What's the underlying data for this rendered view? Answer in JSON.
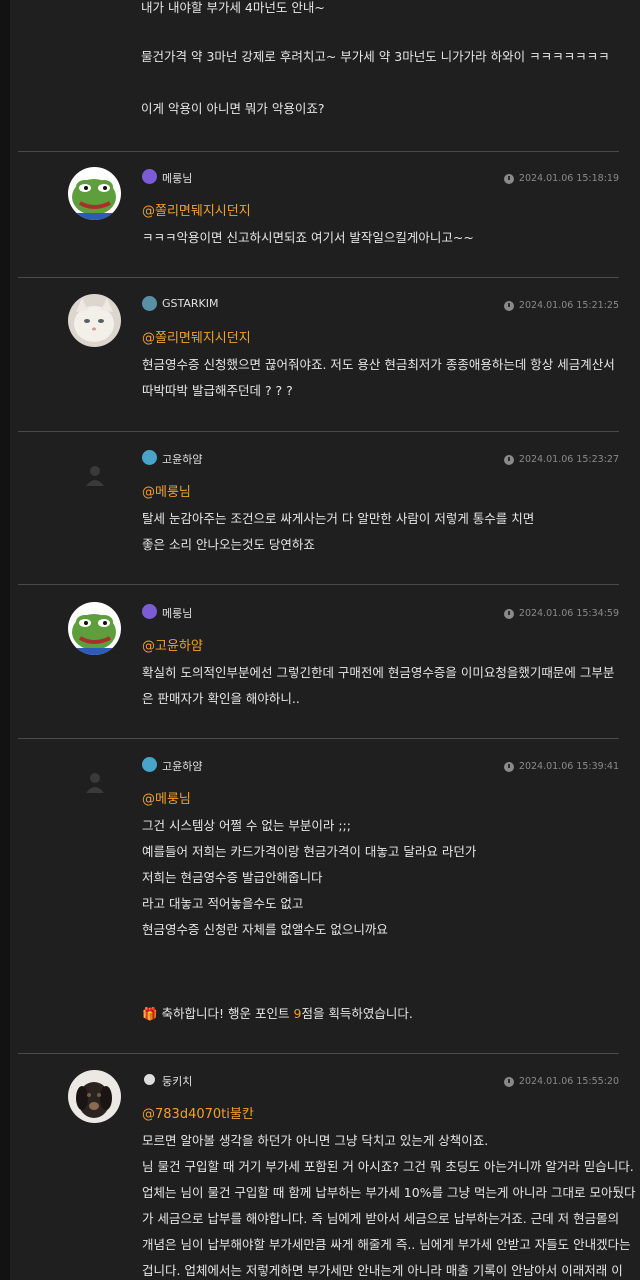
{
  "top_lines": [
    "내가 내야할 부가세 4마넌도 안내~",
    "물건가격 약 3마넌 강제로 후려치고~  부가세 약 3마넌도 니가가라 하와이 ㅋㅋㅋㅋㅋㅋㅋ",
    "이게 악용이 아니면 뭐가 악용이죠?"
  ],
  "comments": [
    {
      "nickname": "메룽님",
      "time": "2024.01.06 15:18:19",
      "mention": "@쫄리면뒈지시던지",
      "lines": [
        "ㅋㅋㅋ악용이면 신고하시면되죠 여기서 발작일으킬게아니고~~"
      ],
      "avatar": "pepe-avatar",
      "level_color": "#7b5cd6"
    },
    {
      "nickname": "GSTARKIM",
      "time": "2024.01.06 15:21:25",
      "mention": "@쫄리면뒈지시던지",
      "lines": [
        "현금영수증 신청했으면 끊어줘야죠. 저도 용산 현금최저가 종종애용하는데 항상 세금계산서",
        "따박따박 발급해주던데 ? ? ?"
      ],
      "avatar": "cat-avatar",
      "level_color": "#5a8fa8"
    },
    {
      "nickname": "고윤하얌",
      "time": "2024.01.06 15:23:27",
      "mention": "@메룽님",
      "lines": [
        "탈세 눈감아주는 조건으로 싸게사는거 다 알만한 사람이 저렇게 통수를 치면",
        "좋은 소리 안나오는것도 당연하죠"
      ],
      "avatar": "default-avatar",
      "level_color": "#4aa3c8"
    },
    {
      "nickname": "메룽님",
      "time": "2024.01.06 15:34:59",
      "mention": "@고윤하얌",
      "lines": [
        "확실히 도의적인부분에선 그렇긴한데 구매전에 현금영수증을 이미요청을했기때문에 그부분",
        "은 판매자가 확인을 해야하니.."
      ],
      "avatar": "pepe-avatar",
      "level_color": "#7b5cd6"
    },
    {
      "nickname": "고윤하얌",
      "time": "2024.01.06 15:39:41",
      "mention": "@메룽님",
      "lines": [
        "그건 시스템상 어쩔 수 없는 부분이라 ;;;",
        "예를들어 저희는 카드가격이랑 현금가격이 대놓고 달라요 라던가",
        "저희는 현금영수증 발급안해줍니다",
        "라고 대놓고 적어놓을수도 없고",
        "현금영수증 신청란 자체를 없앨수도 없으니까요"
      ],
      "notice": {
        "prefix": "축하합니다! 행운 포인트 ",
        "points": "9",
        "suffix": "점을 획득하였습니다."
      },
      "avatar": "default-avatar",
      "level_color": "#4aa3c8"
    },
    {
      "nickname": "둥키치",
      "time": "2024.01.06 15:55:20",
      "mention": "@783d4070ti불칸",
      "lines": [
        "모르면 알아볼 생각을 하던가 아니면 그냥 닥치고 있는게 상책이죠.",
        "님 물건 구입할 때 거기 부가세 포함된 거 아시죠? 그건 뭐 초딩도 아는거니까 알거라 믿습니다.",
        "업체는 님이 물건 구입할 때 함께 납부하는 부가세 10%를 그냥 먹는게 아니라 그대로 모아뒀다",
        "가 세금으로 납부를 해야합니다. 즉 님에게 받아서 세금으로 납부하는거죠. 근데 저 현금몰의",
        "개념은 님이 납부해야할 부가세만큼 싸게 해줄게 즉.. 님에게 부가세 안받고 자들도 안내겠다는",
        "겁니다. 업체에서는 저렇게하면 부가세만 안내는게 아니라 매출 기록이 안남아서 이래저래 이"
      ],
      "avatar": "dog-avatar",
      "level_color": "#dddddd"
    }
  ]
}
